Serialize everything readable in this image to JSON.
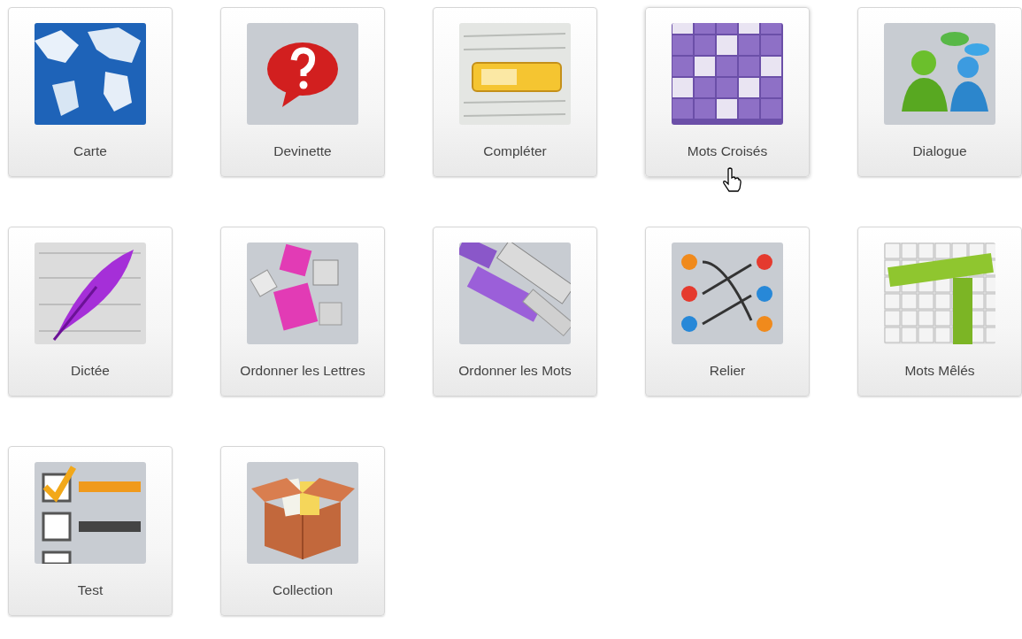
{
  "tiles": [
    {
      "label": "Carte",
      "hovered": false
    },
    {
      "label": "Devinette",
      "hovered": false
    },
    {
      "label": "Compléter",
      "hovered": false
    },
    {
      "label": "Mots Croisés",
      "hovered": true
    },
    {
      "label": "Dialogue",
      "hovered": false
    },
    {
      "label": "Dictée",
      "hovered": false
    },
    {
      "label": "Ordonner les Lettres",
      "hovered": false
    },
    {
      "label": "Ordonner les Mots",
      "hovered": false
    },
    {
      "label": "Relier",
      "hovered": false
    },
    {
      "label": "Mots Mêlés",
      "hovered": false
    },
    {
      "label": "Test",
      "hovered": false
    },
    {
      "label": "Collection",
      "hovered": false
    }
  ]
}
